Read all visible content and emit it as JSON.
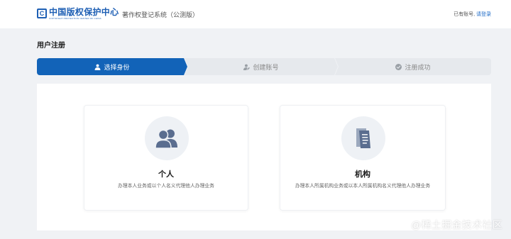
{
  "header": {
    "logo_cn": "中国版权保护中心",
    "logo_en": "COPYRIGHT PROTECTION CENTER OF CHINA",
    "logo_mark": "C",
    "system_title": "著作权登记系统（公测版）",
    "account_prompt": "已有账号,",
    "login_link": "请登录"
  },
  "page": {
    "title": "用户注册"
  },
  "steps": [
    {
      "label": "选择身份",
      "icon": "user-icon",
      "active": true
    },
    {
      "label": "创建账号",
      "icon": "user-edit-icon",
      "active": false
    },
    {
      "label": "注册成功",
      "icon": "check-circle-icon",
      "active": false
    }
  ],
  "cards": {
    "personal": {
      "title": "个人",
      "description": "办理本人业务或以个人名义代理他人办理业务",
      "icon": "users-icon"
    },
    "organization": {
      "title": "机构",
      "description": "办理本人所属机构业务或以本人所属机构名义代理他人办理业务",
      "icon": "document-icon"
    }
  },
  "watermark": "@稀土掘金技术社区",
  "colors": {
    "primary": "#1263b8",
    "brand": "#1e5fb4",
    "link": "#1e6bc7",
    "step_inactive": "#e6e9ed",
    "icon_fill": "#5a6d8f",
    "page_background": "#f0f2f5"
  }
}
